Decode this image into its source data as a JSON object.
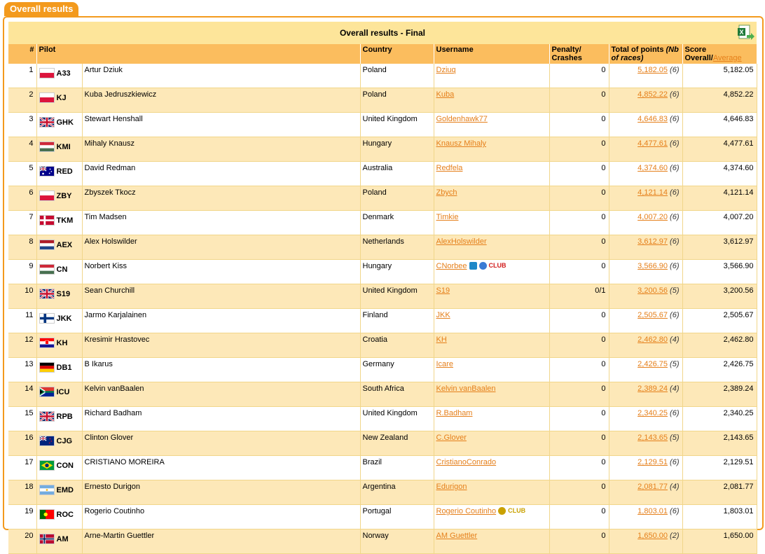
{
  "tab_label": "Overall results",
  "title": "Overall results - Final",
  "export_icon": "excel-export-icon",
  "headers": {
    "rank": "#",
    "pilot": "Pilot",
    "country": "Country",
    "username": "Username",
    "penalty": "Penalty/ Crashes",
    "total": "Total of points",
    "total_sub": "(Nb of races)",
    "score": "Score",
    "score_overall": "Overall/",
    "score_average": "Average"
  },
  "rows": [
    {
      "rank": "1",
      "code": "A33",
      "name": "Artur Dziuk",
      "country": "Poland",
      "flag": "pl",
      "username": "Dziuq",
      "penalty": "0",
      "points": "5,182.05",
      "races": "(6)",
      "score": "5,182.05"
    },
    {
      "rank": "2",
      "code": "KJ",
      "name": "Kuba Jedruszkiewicz",
      "country": "Poland",
      "flag": "pl",
      "username": "Kuba",
      "penalty": "0",
      "points": "4,852.22",
      "races": "(6)",
      "score": "4,852.22"
    },
    {
      "rank": "3",
      "code": "GHK",
      "name": "Stewart Henshall",
      "country": "United Kingdom",
      "flag": "gb",
      "username": "Goldenhawk77",
      "penalty": "0",
      "points": "4,646.83",
      "races": "(6)",
      "score": "4,646.83"
    },
    {
      "rank": "4",
      "code": "KMI",
      "name": "Mihaly Knausz",
      "country": "Hungary",
      "flag": "hu",
      "username": "Knausz Mihaly",
      "penalty": "0",
      "points": "4,477.61",
      "races": "(6)",
      "score": "4,477.61"
    },
    {
      "rank": "5",
      "code": "RED",
      "name": "David Redman",
      "country": "Australia",
      "flag": "au",
      "username": "Redfela",
      "penalty": "0",
      "points": "4,374.60",
      "races": "(6)",
      "score": "4,374.60"
    },
    {
      "rank": "6",
      "code": "ZBY",
      "name": "Zbyszek Tkocz",
      "country": "Poland",
      "flag": "pl",
      "username": "Zbych",
      "penalty": "0",
      "points": "4,121.14",
      "races": "(6)",
      "score": "4,121.14"
    },
    {
      "rank": "7",
      "code": "TKM",
      "name": "Tim Madsen",
      "country": "Denmark",
      "flag": "dk",
      "username": "Timkie",
      "penalty": "0",
      "points": "4,007.20",
      "races": "(6)",
      "score": "4,007.20"
    },
    {
      "rank": "8",
      "code": "AEX",
      "name": "Alex Holswilder",
      "country": "Netherlands",
      "flag": "nl",
      "username": "AlexHolswilder",
      "penalty": "0",
      "points": "3,612.97",
      "races": "(6)",
      "score": "3,612.97"
    },
    {
      "rank": "9",
      "code": "CN",
      "name": "Norbert Kiss",
      "country": "Hungary",
      "flag": "hu",
      "username": "CNorbee",
      "penalty": "0",
      "points": "3,566.90",
      "races": "(6)",
      "score": "3,566.90",
      "club": "CLUB",
      "club_style": "red"
    },
    {
      "rank": "10",
      "code": "S19",
      "name": "Sean Churchill",
      "country": "United Kingdom",
      "flag": "gb",
      "username": "S19",
      "penalty": "0/1",
      "points": "3,200.56",
      "races": "(5)",
      "score": "3,200.56"
    },
    {
      "rank": "11",
      "code": "JKK",
      "name": "Jarmo Karjalainen",
      "country": "Finland",
      "flag": "fi",
      "username": "JKK",
      "penalty": "0",
      "points": "2,505.67",
      "races": "(6)",
      "score": "2,505.67"
    },
    {
      "rank": "12",
      "code": "KH",
      "name": "Kresimir Hrastovec",
      "country": "Croatia",
      "flag": "hr",
      "username": "KH",
      "penalty": "0",
      "points": "2,462.80",
      "races": "(4)",
      "score": "2,462.80"
    },
    {
      "rank": "13",
      "code": "DB1",
      "name": "B Ikarus",
      "country": "Germany",
      "flag": "de",
      "username": "Icare",
      "penalty": "0",
      "points": "2,426.75",
      "races": "(5)",
      "score": "2,426.75"
    },
    {
      "rank": "14",
      "code": "ICU",
      "name": "Kelvin vanBaalen",
      "country": "South Africa",
      "flag": "za",
      "username": "Kelvin vanBaalen",
      "penalty": "0",
      "points": "2,389.24",
      "races": "(4)",
      "score": "2,389.24"
    },
    {
      "rank": "15",
      "code": "RPB",
      "name": "Richard Badham",
      "country": "United Kingdom",
      "flag": "gb",
      "username": "R.Badham",
      "penalty": "0",
      "points": "2,340.25",
      "races": "(6)",
      "score": "2,340.25"
    },
    {
      "rank": "16",
      "code": "CJG",
      "name": "Clinton Glover",
      "country": "New Zealand",
      "flag": "nz",
      "username": "C.Glover",
      "penalty": "0",
      "points": "2,143.65",
      "races": "(5)",
      "score": "2,143.65"
    },
    {
      "rank": "17",
      "code": "CON",
      "name": "CRISTIANO MOREIRA",
      "country": "Brazil",
      "flag": "br",
      "username": "CristianoConrado",
      "penalty": "0",
      "points": "2,129.51",
      "races": "(6)",
      "score": "2,129.51"
    },
    {
      "rank": "18",
      "code": "EMD",
      "name": "Ernesto Durigon",
      "country": "Argentina",
      "flag": "ar",
      "username": "Edurigon",
      "penalty": "0",
      "points": "2,081.77",
      "races": "(4)",
      "score": "2,081.77"
    },
    {
      "rank": "19",
      "code": "ROC",
      "name": "Rogerio Coutinho",
      "country": "Portugal",
      "flag": "pt",
      "username": "Rogerio Coutinho",
      "penalty": "0",
      "points": "1,803.01",
      "races": "(6)",
      "score": "1,803.01",
      "club": "CLUB",
      "club_style": "gold"
    },
    {
      "rank": "20",
      "code": "AM",
      "name": "Arne-Martin Guettler",
      "country": "Norway",
      "flag": "no",
      "username": "AM Guettler",
      "penalty": "0",
      "points": "1,650.00",
      "races": "(2)",
      "score": "1,650.00"
    }
  ]
}
